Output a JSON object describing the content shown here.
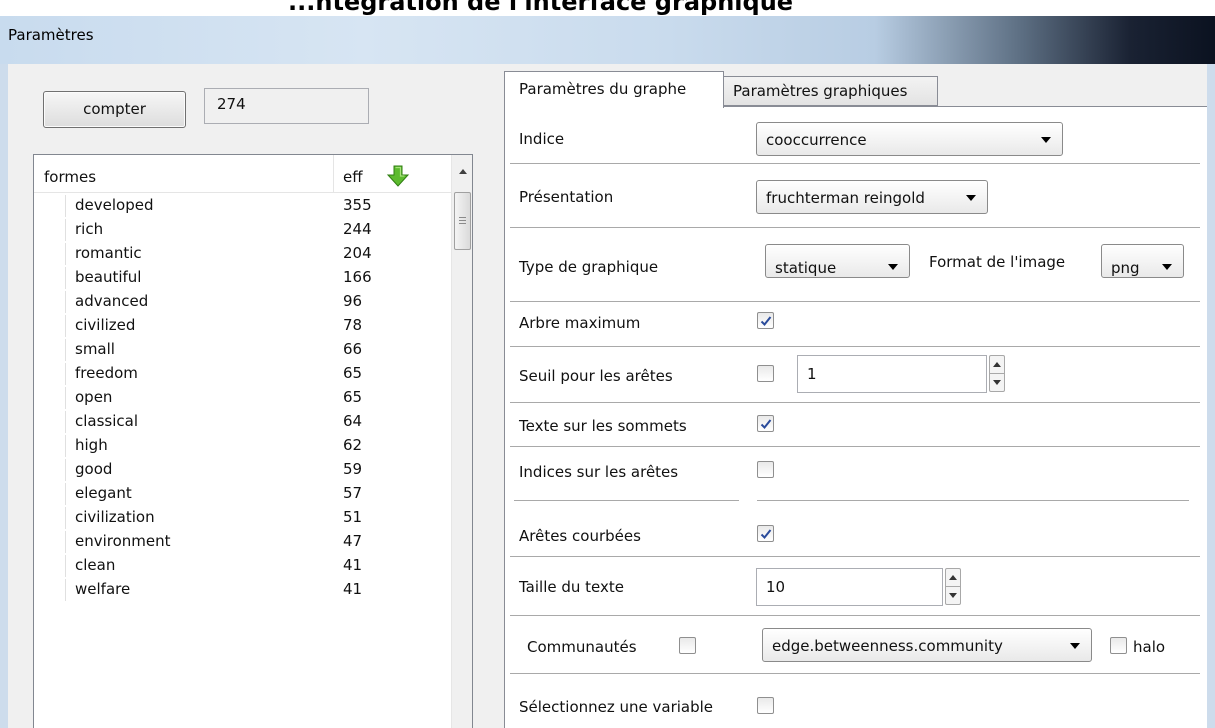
{
  "window": {
    "top_text": "...ntégration de l'interface graphique",
    "title": "Paramètres"
  },
  "left": {
    "count_button": "compter",
    "count_value": "274",
    "list": {
      "col_forms": "formes",
      "col_eff": "eff",
      "sort_icon": "green-down-arrow-icon",
      "rows": [
        {
          "form": "developed",
          "eff": "355"
        },
        {
          "form": "rich",
          "eff": "244"
        },
        {
          "form": "romantic",
          "eff": "204"
        },
        {
          "form": "beautiful",
          "eff": "166"
        },
        {
          "form": "advanced",
          "eff": "96"
        },
        {
          "form": "civilized",
          "eff": "78"
        },
        {
          "form": "small",
          "eff": "66"
        },
        {
          "form": "freedom",
          "eff": "65"
        },
        {
          "form": "open",
          "eff": "65"
        },
        {
          "form": "classical",
          "eff": "64"
        },
        {
          "form": "high",
          "eff": "62"
        },
        {
          "form": "good",
          "eff": "59"
        },
        {
          "form": "elegant",
          "eff": "57"
        },
        {
          "form": "civilization",
          "eff": "51"
        },
        {
          "form": "environment",
          "eff": "47"
        },
        {
          "form": "clean",
          "eff": "41"
        },
        {
          "form": "welfare",
          "eff": "41"
        }
      ]
    }
  },
  "tabs": {
    "active": "Paramètres du graphe",
    "inactive": "Paramètres graphiques"
  },
  "params": {
    "indice_label": "Indice",
    "indice_value": "cooccurrence",
    "presentation_label": "Présentation",
    "presentation_value": "fruchterman reingold",
    "type_label": "Type de graphique",
    "type_value": "statique",
    "format_label": "Format de l'image",
    "format_value": "png",
    "arbre_label": "Arbre maximum",
    "arbre_checked": true,
    "seuil_label": "Seuil pour les arêtes",
    "seuil_checked": false,
    "seuil_value": "1",
    "texte_label": "Texte sur les sommets",
    "texte_checked": true,
    "indices_label": "Indices sur les arêtes",
    "indices_checked": false,
    "courbees_label": "Arêtes courbées",
    "courbees_checked": true,
    "taille_label": "Taille du texte",
    "taille_value": "10",
    "communautes_label": "Communautés",
    "communautes_checked": false,
    "communautes_method": "edge.betweenness.community",
    "halo_label": "halo",
    "halo_checked": false,
    "variable_label": "Sélectionnez une variable",
    "variable_checked": false
  }
}
